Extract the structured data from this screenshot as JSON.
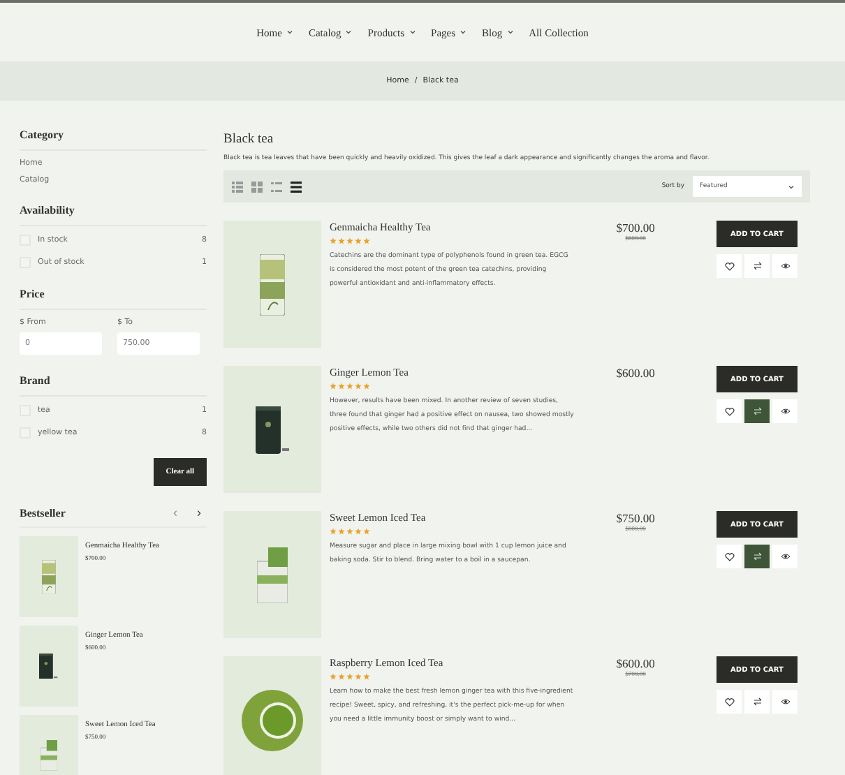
{
  "nav": [
    {
      "label": "Home",
      "dropdown": true
    },
    {
      "label": "Catalog",
      "dropdown": true
    },
    {
      "label": "Products",
      "dropdown": true
    },
    {
      "label": "Pages",
      "dropdown": true
    },
    {
      "label": "Blog",
      "dropdown": true
    },
    {
      "label": "All Collection",
      "dropdown": false
    }
  ],
  "breadcrumb": [
    "Home",
    "/",
    "Black tea"
  ],
  "sidebar": {
    "category": {
      "title": "Category",
      "items": [
        "Home",
        "Catalog"
      ]
    },
    "availability": {
      "title": "Availability",
      "items": [
        {
          "label": "In stock",
          "count": "8",
          "checked": false
        },
        {
          "label": "Out of stock",
          "count": "1",
          "checked": false
        }
      ]
    },
    "price": {
      "title": "Price",
      "from_label": "$ From",
      "from_placeholder": "0",
      "to_label": "$ To",
      "to_placeholder": "750.00"
    },
    "brand": {
      "title": "Brand",
      "items": [
        {
          "label": "tea",
          "count": "1",
          "checked": false
        },
        {
          "label": "yellow tea",
          "count": "8",
          "checked": false
        }
      ]
    },
    "clear_button": "Clear all",
    "bestseller": {
      "title": "Bestseller",
      "prev": "‹",
      "next": "›",
      "items": [
        {
          "name": "Genmaicha Healthy Tea",
          "price": "$700.00",
          "kind": "jar"
        },
        {
          "name": "Ginger Lemon Tea",
          "price": "$600.00",
          "kind": "tin"
        },
        {
          "name": "Sweet Lemon Iced Tea",
          "price": "$750.00",
          "kind": "box"
        }
      ]
    }
  },
  "main": {
    "title": "Black tea",
    "description": "Black tea is tea leaves that have been quickly and heavily oxidized. This gives the leaf a dark appearance and significantly changes the aroma and flavor.",
    "views": [
      {
        "kind": "list-small",
        "selected": false
      },
      {
        "kind": "grid",
        "selected": false
      },
      {
        "kind": "list",
        "selected": false
      },
      {
        "kind": "rows",
        "selected": true
      }
    ],
    "sort_label": "Sort by",
    "sort_value": "Featured",
    "products": [
      {
        "name": "Genmaicha Healthy Tea",
        "stars": 5,
        "price": "$700.00",
        "old_price": "$800.00",
        "kind": "jar",
        "description": "Catechins are the dominant type of polyphenols found in green tea. EGCG is considered the most potent of the green tea catechins, providing powerful antioxidant and anti-inflammatory effects.",
        "button": "ADD TO CART",
        "compare_active": false
      },
      {
        "name": "Ginger Lemon Tea",
        "stars": 5,
        "price": "$600.00",
        "kind": "tin",
        "description": "However, results have been mixed. In another review of seven studies, three found that ginger had a positive effect on nausea, two showed mostly positive effects, while two others did not find that ginger had...",
        "button": "ADD TO CART",
        "compare_active": true
      },
      {
        "name": "Sweet Lemon Iced Tea",
        "stars": 5,
        "price": "$750.00",
        "old_price": "$800.00",
        "kind": "box",
        "description": "Measure sugar and place in large mixing bowl with 1 cup lemon juice and baking soda. Stir to blend. Bring water to a boil in a saucepan.",
        "button": "ADD TO CART",
        "compare_active": true
      },
      {
        "name": "Raspberry Lemon Iced Tea",
        "stars": 5,
        "price": "$600.00",
        "old_price": "$700.00",
        "kind": "bowl",
        "description": "Learn how to make the best fresh lemon ginger tea with this five-ingredient recipe! Sweet, spicy, and refreshing, it's the perfect pick-me-up for when you need a little immunity boost or simply want to wind...",
        "button": "ADD TO CART",
        "compare_active": false
      }
    ]
  }
}
